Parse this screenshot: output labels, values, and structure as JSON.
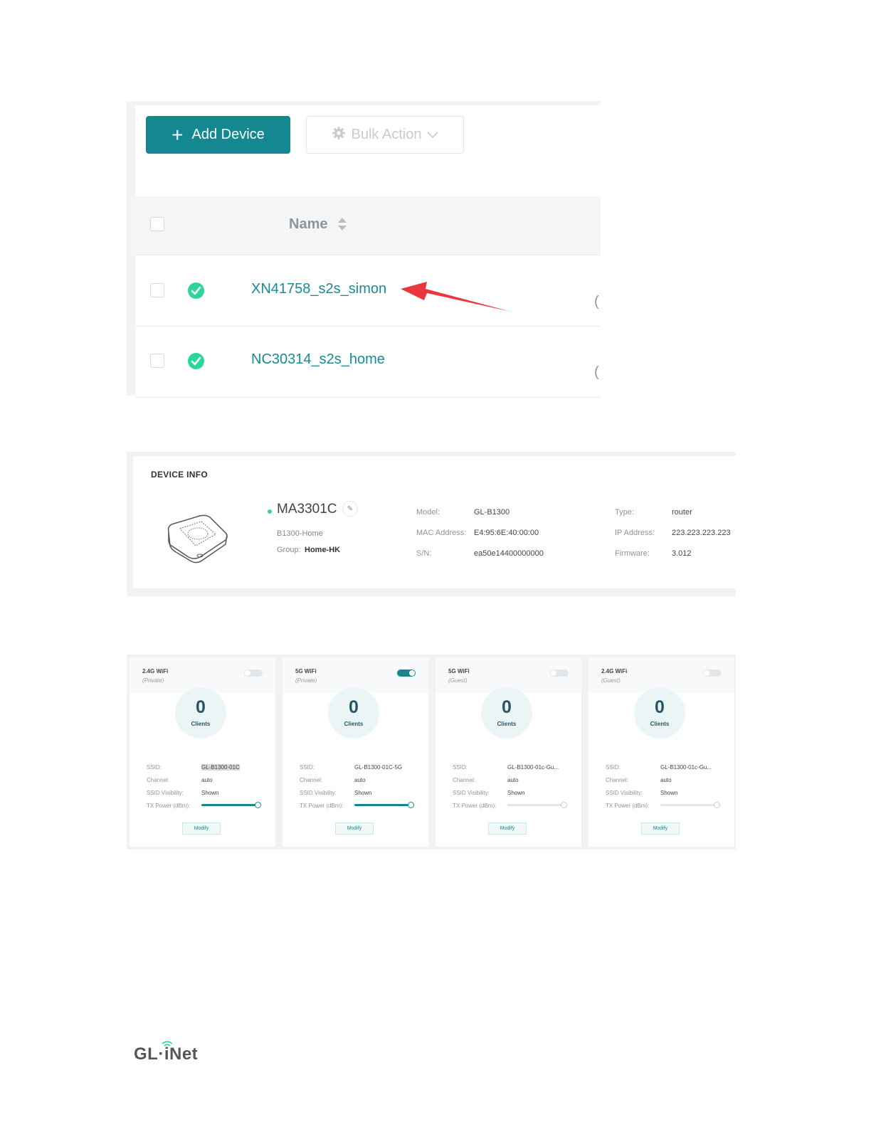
{
  "toolbar": {
    "add_label": "Add Device",
    "bulk_label": "Bulk Action"
  },
  "table": {
    "name_header": "Name",
    "rows": [
      {
        "name": "XN41758_s2s_simon",
        "status": "online"
      },
      {
        "name": "NC30314_s2s_home",
        "status": "online"
      }
    ],
    "cut_glyph": "("
  },
  "device_info": {
    "title": "DEVICE INFO",
    "name": "MA3301C",
    "edit_glyph": "✎",
    "subtitle": "B1300-Home",
    "group_label": "Group:",
    "group_value": "Home-HK",
    "fields": [
      {
        "label": "Model:",
        "value": "GL-B1300"
      },
      {
        "label": "MAC Address:",
        "value": "E4:95:6E:40:00:00"
      },
      {
        "label": "S/N:",
        "value": "ea50e14400000000"
      },
      {
        "label": "Type:",
        "value": "router"
      },
      {
        "label": "IP Address:",
        "value": "223.223.223.223"
      },
      {
        "label": "Firmware:",
        "value": "3.012"
      }
    ]
  },
  "wifi_cards": [
    {
      "title": "2.4G WiFi",
      "subtitle": "(Private)",
      "enabled": false,
      "clients": "0",
      "clients_label": "Clients",
      "ssid_label": "SSID:",
      "ssid": "GL-B1300-01C",
      "channel_label": "Channel:",
      "channel": "auto",
      "visibility_label": "SSID Visibility:",
      "visibility": "Shown",
      "tx_label": "TX Power (dBm):",
      "tx_fraction": 1.0,
      "modify_label": "Modify"
    },
    {
      "title": "5G WiFi",
      "subtitle": "(Private)",
      "enabled": true,
      "clients": "0",
      "clients_label": "Clients",
      "ssid_label": "SSID:",
      "ssid": "GL-B1300-01C-5G",
      "channel_label": "Channel:",
      "channel": "auto",
      "visibility_label": "SSID Visibility:",
      "visibility": "Shown",
      "tx_label": "TX Power (dBm):",
      "tx_fraction": 1.0,
      "modify_label": "Modify"
    },
    {
      "title": "5G WiFi",
      "subtitle": "(Guest)",
      "enabled": false,
      "clients": "0",
      "clients_label": "Clients",
      "ssid_label": "SSID:",
      "ssid": "GL-B1300-01c-Gu...",
      "channel_label": "Channel:",
      "channel": "auto",
      "visibility_label": "SSID Visibility:",
      "visibility": "Shown",
      "tx_label": "TX Power (dBm):",
      "tx_fraction": 1.0,
      "modify_label": "Modify"
    },
    {
      "title": "2.4G WiFi",
      "subtitle": "(Guest)",
      "enabled": false,
      "clients": "0",
      "clients_label": "Clients",
      "ssid_label": "SSID:",
      "ssid": "GL-B1300-01c-Gu...",
      "channel_label": "Channel:",
      "channel": "auto",
      "visibility_label": "SSID Visibility:",
      "visibility": "Shown",
      "tx_label": "TX Power (dBm):",
      "tx_fraction": 1.0,
      "modify_label": "Modify"
    }
  ],
  "footer": {
    "logo_text": "GL·iNet"
  },
  "colors": {
    "accent": "#138891",
    "online": "#2cd69b",
    "arrow": "#e8383d"
  }
}
